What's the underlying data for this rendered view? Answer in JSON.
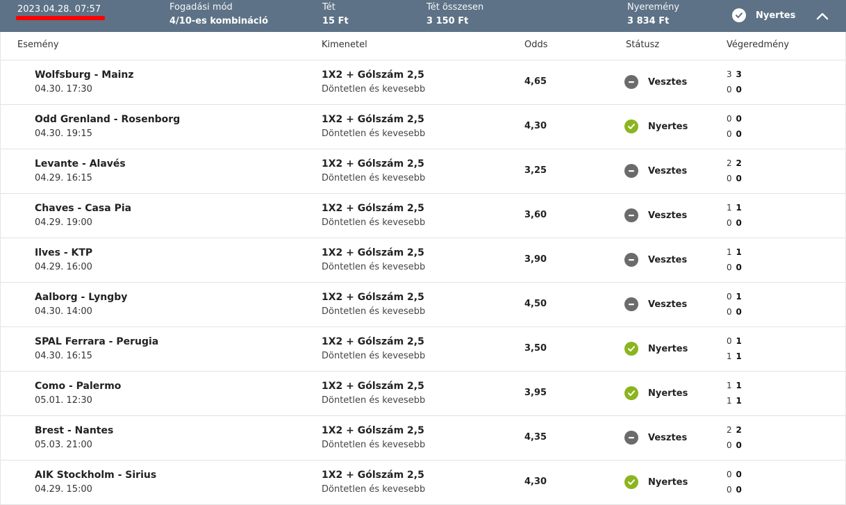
{
  "header": {
    "date": "2023.04.28. 07:57",
    "bet_type_label": "Fogadási mód",
    "bet_type_value": "4/10-es kombináció",
    "stake_label": "Tét",
    "stake_value": "15 Ft",
    "total_stake_label": "Tét összesen",
    "total_stake_value": "3 150 Ft",
    "winnings_label": "Nyeremény",
    "winnings_value": "3 834 Ft",
    "status_label": "Nyertes"
  },
  "columns": {
    "event": "Esemény",
    "outcome": "Kimenetel",
    "odds": "Odds",
    "status": "Státusz",
    "result": "Végeredmény"
  },
  "rows": [
    {
      "event": "Wolfsburg - Mainz",
      "date": "04.30. 17:30",
      "market": "1X2 + Gólszám 2,5",
      "selection": "Döntetlen és kevesebb",
      "odds": "4,65",
      "status": "Vesztes",
      "status_type": "lose",
      "score1_a": "3",
      "score1_b": "3",
      "score2_a": "0",
      "score2_b": "0"
    },
    {
      "event": "Odd Grenland - Rosenborg",
      "date": "04.30. 19:15",
      "market": "1X2 + Gólszám 2,5",
      "selection": "Döntetlen és kevesebb",
      "odds": "4,30",
      "status": "Nyertes",
      "status_type": "win",
      "score1_a": "0",
      "score1_b": "0",
      "score2_a": "0",
      "score2_b": "0"
    },
    {
      "event": "Levante - Alavés",
      "date": "04.29. 16:15",
      "market": "1X2 + Gólszám 2,5",
      "selection": "Döntetlen és kevesebb",
      "odds": "3,25",
      "status": "Vesztes",
      "status_type": "lose",
      "score1_a": "2",
      "score1_b": "2",
      "score2_a": "0",
      "score2_b": "0"
    },
    {
      "event": "Chaves - Casa Pia",
      "date": "04.29. 19:00",
      "market": "1X2 + Gólszám 2,5",
      "selection": "Döntetlen és kevesebb",
      "odds": "3,60",
      "status": "Vesztes",
      "status_type": "lose",
      "score1_a": "1",
      "score1_b": "1",
      "score2_a": "0",
      "score2_b": "0"
    },
    {
      "event": "Ilves - KTP",
      "date": "04.29. 16:00",
      "market": "1X2 + Gólszám 2,5",
      "selection": "Döntetlen és kevesebb",
      "odds": "3,90",
      "status": "Vesztes",
      "status_type": "lose",
      "score1_a": "1",
      "score1_b": "1",
      "score2_a": "0",
      "score2_b": "0"
    },
    {
      "event": "Aalborg - Lyngby",
      "date": "04.30. 14:00",
      "market": "1X2 + Gólszám 2,5",
      "selection": "Döntetlen és kevesebb",
      "odds": "4,50",
      "status": "Vesztes",
      "status_type": "lose",
      "score1_a": "0",
      "score1_b": "1",
      "score2_a": "0",
      "score2_b": "0"
    },
    {
      "event": "SPAL Ferrara - Perugia",
      "date": "04.30. 16:15",
      "market": "1X2 + Gólszám 2,5",
      "selection": "Döntetlen és kevesebb",
      "odds": "3,50",
      "status": "Nyertes",
      "status_type": "win",
      "score1_a": "0",
      "score1_b": "1",
      "score2_a": "1",
      "score2_b": "1"
    },
    {
      "event": "Como - Palermo",
      "date": "05.01. 12:30",
      "market": "1X2 + Gólszám 2,5",
      "selection": "Döntetlen és kevesebb",
      "odds": "3,95",
      "status": "Nyertes",
      "status_type": "win",
      "score1_a": "1",
      "score1_b": "1",
      "score2_a": "1",
      "score2_b": "1"
    },
    {
      "event": "Brest - Nantes",
      "date": "05.03. 21:00",
      "market": "1X2 + Gólszám 2,5",
      "selection": "Döntetlen és kevesebb",
      "odds": "4,35",
      "status": "Vesztes",
      "status_type": "lose",
      "score1_a": "2",
      "score1_b": "2",
      "score2_a": "0",
      "score2_b": "0"
    },
    {
      "event": "AIK Stockholm - Sirius",
      "date": "04.29. 15:00",
      "market": "1X2 + Gólszám 2,5",
      "selection": "Döntetlen és kevesebb",
      "odds": "4,30",
      "status": "Nyertes",
      "status_type": "win",
      "score1_a": "0",
      "score1_b": "0",
      "score2_a": "0",
      "score2_b": "0"
    }
  ]
}
